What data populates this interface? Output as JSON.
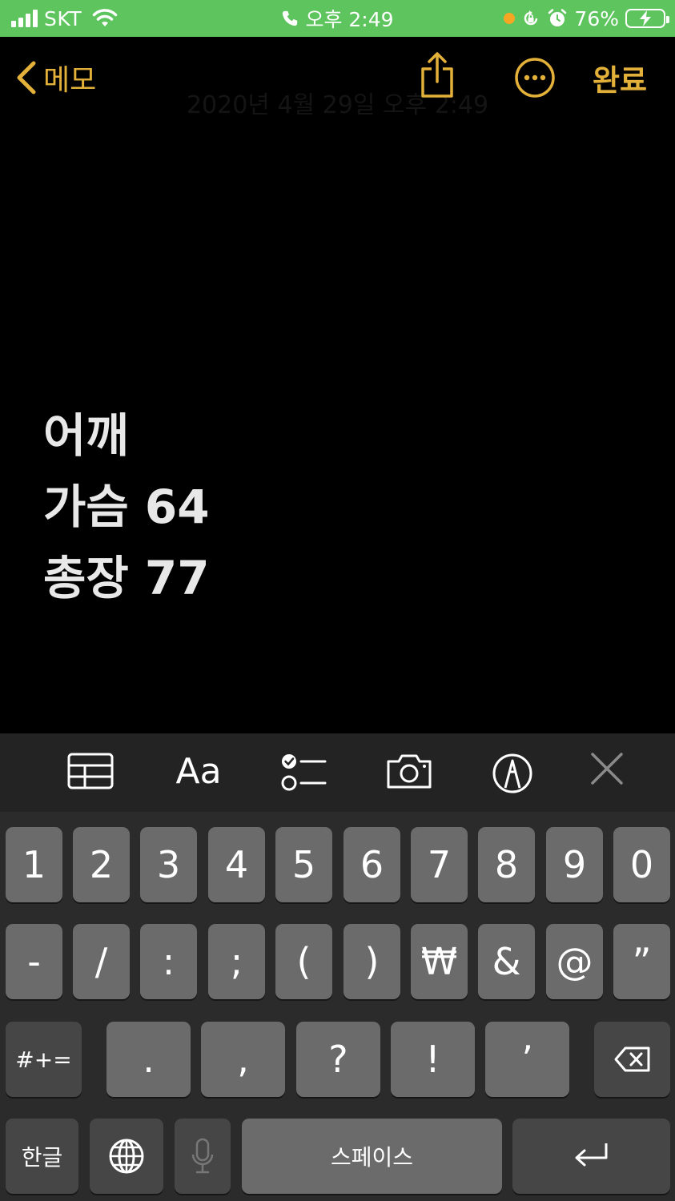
{
  "status_bar": {
    "carrier": "SKT",
    "time": "오후 2:49",
    "battery_percent": "76%"
  },
  "nav": {
    "back_label": "메모",
    "done_label": "완료",
    "faded_date": "2020년 4월 29일 오후 2:49"
  },
  "note": {
    "lines": [
      "어깨",
      "가슴 64",
      "총장 77"
    ]
  },
  "toolbar": {
    "format_label": "Aa"
  },
  "keyboard": {
    "row1": [
      "1",
      "2",
      "3",
      "4",
      "5",
      "6",
      "7",
      "8",
      "9",
      "0"
    ],
    "row2": [
      "-",
      "/",
      ":",
      ";",
      "(",
      ")",
      "₩",
      "&",
      "@",
      "”"
    ],
    "row3_toggle": "#+=",
    "row3": [
      ".",
      ",",
      "?",
      "!",
      "’"
    ],
    "lang_label": "한글",
    "space_label": "스페이스"
  },
  "colors": {
    "accent": "#e3b13a",
    "status_bar_bg": "#5ec45e",
    "key_bg": "#6b6b6b",
    "key_dark_bg": "#464646",
    "keyboard_bg": "#2b2b2b"
  }
}
